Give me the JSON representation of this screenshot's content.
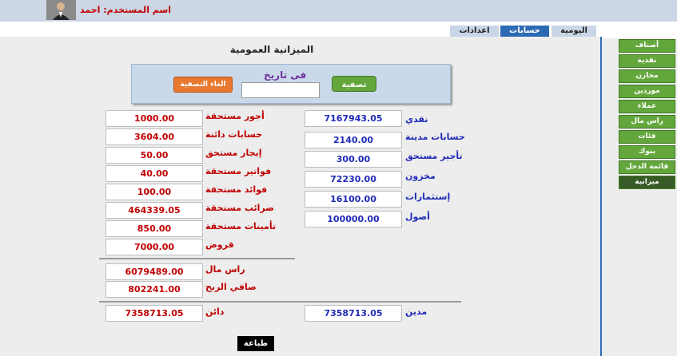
{
  "header": {
    "username_label": "اسم المستخدم: احمد"
  },
  "tabs": {
    "daily": "اليومية",
    "accounts": "حسابات",
    "settings": "اعدادات"
  },
  "page": {
    "title": "الميزانية العمومية"
  },
  "filter": {
    "date_label": "فى تاريخ",
    "date_value": "",
    "settle_button": "تصفية",
    "cancel_settle_button": "الغاء التصفية"
  },
  "liabilities": [
    {
      "label": "أجور مستحقة",
      "value": "1000.00"
    },
    {
      "label": "حسابات دائنة",
      "value": "3604.00"
    },
    {
      "label": "إيجار مستحق",
      "value": "50.00"
    },
    {
      "label": "فواتير مستحقة",
      "value": "40.00"
    },
    {
      "label": "فوائد مستحقة",
      "value": "100.00"
    },
    {
      "label": "ضرائب مستحقة",
      "value": "464339.05"
    },
    {
      "label": "تأمينات مستحقة",
      "value": "850.00"
    },
    {
      "label": "قروض",
      "value": "7000.00"
    }
  ],
  "equity": [
    {
      "label": "راس مال",
      "value": "6079489.00"
    },
    {
      "label": "صافي الربح",
      "value": "802241.00"
    }
  ],
  "assets": [
    {
      "label": "نقدي",
      "value": "7167943.05"
    },
    {
      "label": "حسابات مدينة",
      "value": "2140.00"
    },
    {
      "label": "تأجير مستحق",
      "value": "300.00"
    },
    {
      "label": "مخزون",
      "value": "72230.00"
    },
    {
      "label": "إستثمارات",
      "value": "16100.00"
    },
    {
      "label": "أصول",
      "value": "100000.00"
    }
  ],
  "totals": {
    "credit_label": "دائن",
    "credit_value": "7358713.05",
    "debit_label": "مدين",
    "debit_value": "7358713.05"
  },
  "print_button": "طباعة",
  "sidebar": {
    "items": [
      {
        "label": "أصناف"
      },
      {
        "label": "نقدية"
      },
      {
        "label": "مخازن"
      },
      {
        "label": "موردين"
      },
      {
        "label": "عملاء"
      },
      {
        "label": "راس مال"
      },
      {
        "label": "فئات"
      },
      {
        "label": "بنوك"
      },
      {
        "label": "قائمة الدخل"
      },
      {
        "label": "ميزانية"
      }
    ]
  },
  "colors": {
    "accent": "#2c6bb4",
    "credit": "#c00000",
    "debit": "#1f2ab8",
    "sidebar_green": "#63a73c",
    "sidebar_active": "#375b27"
  }
}
